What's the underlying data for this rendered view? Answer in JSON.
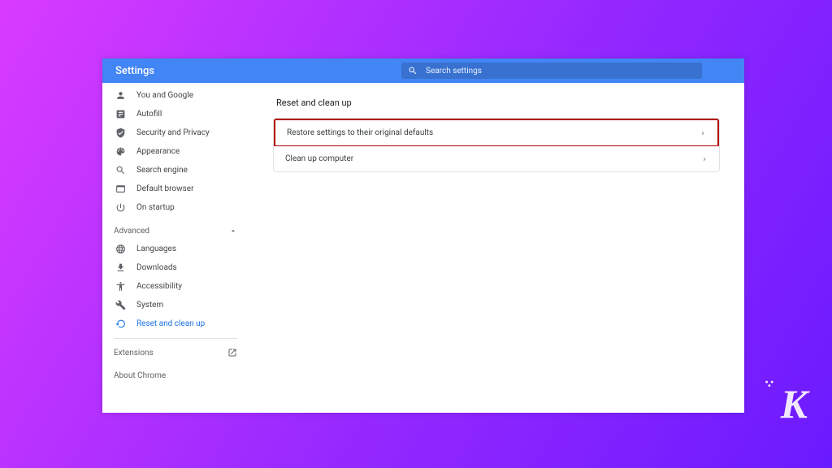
{
  "header": {
    "title": "Settings",
    "search_placeholder": "Search settings"
  },
  "sidebar": {
    "items": [
      {
        "label": "You and Google"
      },
      {
        "label": "Autofill"
      },
      {
        "label": "Security and Privacy"
      },
      {
        "label": "Appearance"
      },
      {
        "label": "Search engine"
      },
      {
        "label": "Default browser"
      },
      {
        "label": "On startup"
      }
    ],
    "advanced_label": "Advanced",
    "advanced_items": [
      {
        "label": "Languages"
      },
      {
        "label": "Downloads"
      },
      {
        "label": "Accessibility"
      },
      {
        "label": "System"
      },
      {
        "label": "Reset and clean up"
      }
    ],
    "extensions_label": "Extensions",
    "about_label": "About Chrome"
  },
  "main": {
    "title": "Reset and clean up",
    "rows": [
      {
        "label": "Restore settings to their original defaults"
      },
      {
        "label": "Clean up computer"
      }
    ]
  },
  "watermark": "K"
}
